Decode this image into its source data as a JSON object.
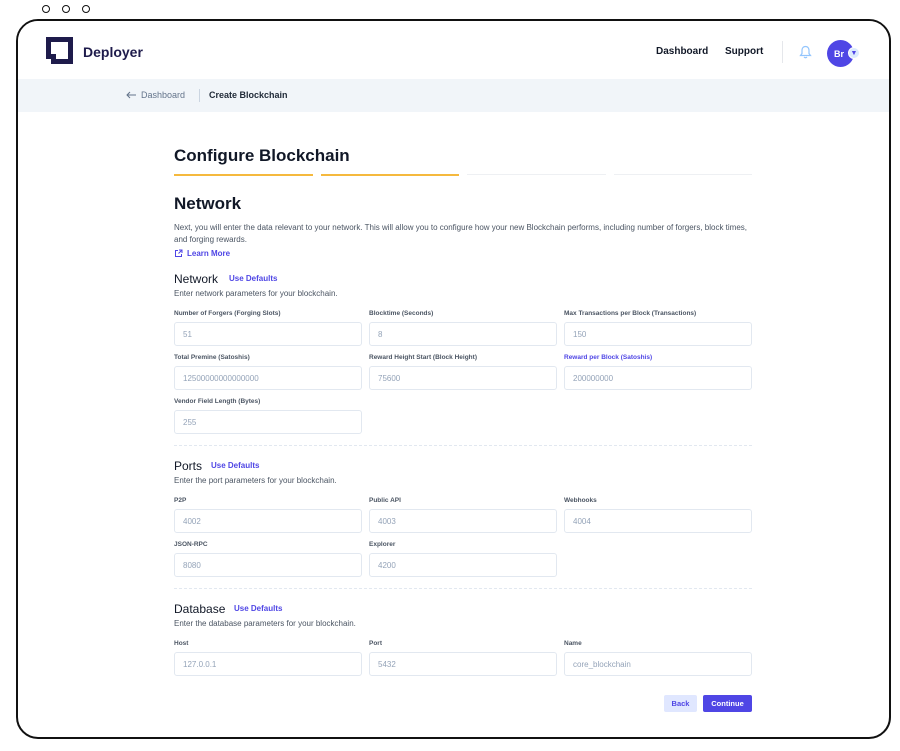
{
  "header": {
    "brand": "Deployer",
    "nav": [
      "Dashboard",
      "Support"
    ],
    "avatar_initials": "Br"
  },
  "breadcrumb": {
    "back_label": "Dashboard",
    "current": "Create Blockchain"
  },
  "page": {
    "title": "Configure Blockchain",
    "steps_done": 2,
    "steps_total": 4,
    "section_title": "Network",
    "intro": "Next, you will enter the data relevant to your network. This will allow you to configure how your new Blockchain performs, including number of forgers, block times, and forging rewards.",
    "learn_more": "Learn More"
  },
  "network": {
    "title": "Network",
    "use_defaults": "Use Defaults",
    "desc": "Enter network parameters for your blockchain.",
    "fields": [
      {
        "label": "Number of Forgers (Forging Slots)",
        "value": "51"
      },
      {
        "label": "Blocktime (Seconds)",
        "value": "8"
      },
      {
        "label": "Max Transactions per Block (Transactions)",
        "value": "150"
      },
      {
        "label": "Total Premine (Satoshis)",
        "value": "12500000000000000"
      },
      {
        "label": "Reward Height Start (Block Height)",
        "value": "75600"
      },
      {
        "label": "Reward per Block (Satoshis)",
        "value": "200000000"
      },
      {
        "label": "Vendor Field Length (Bytes)",
        "value": "255"
      }
    ]
  },
  "ports": {
    "title": "Ports",
    "use_defaults": "Use Defaults",
    "desc": "Enter the port parameters for your blockchain.",
    "fields": [
      {
        "label": "P2P",
        "value": "4002"
      },
      {
        "label": "Public API",
        "value": "4003"
      },
      {
        "label": "Webhooks",
        "value": "4004"
      },
      {
        "label": "JSON-RPC",
        "value": "8080"
      },
      {
        "label": "Explorer",
        "value": "4200"
      }
    ]
  },
  "database": {
    "title": "Database",
    "use_defaults": "Use Defaults",
    "desc": "Enter the database parameters for your blockchain.",
    "fields": [
      {
        "label": "Host",
        "value": "127.0.0.1"
      },
      {
        "label": "Port",
        "value": "5432"
      },
      {
        "label": "Name",
        "value": "core_blockchain"
      }
    ]
  },
  "actions": {
    "back": "Back",
    "continue": "Continue"
  },
  "colors": {
    "accent": "#4f46e5",
    "progress": "#f5b93e",
    "brand_dark": "#1e1b4b"
  }
}
